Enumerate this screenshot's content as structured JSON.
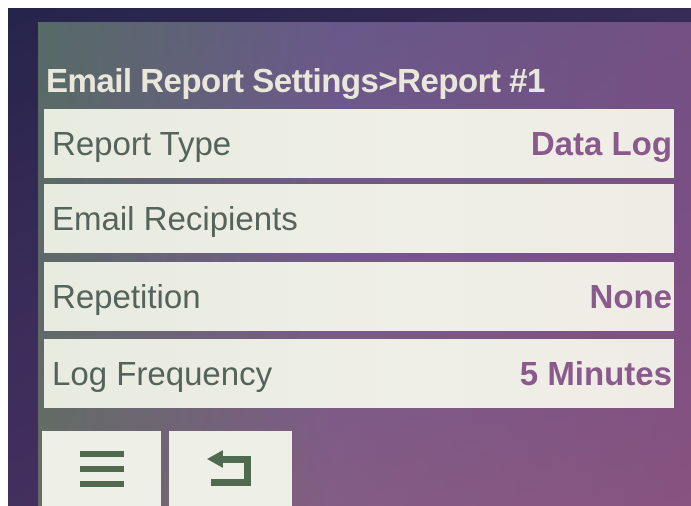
{
  "header": {
    "title": "Email Report Settings>Report #1"
  },
  "rows": [
    {
      "label": "Report Type",
      "value": "Data Log"
    },
    {
      "label": "Email Recipients",
      "value": ""
    },
    {
      "label": "Repetition",
      "value": "None"
    },
    {
      "label": "Log Frequency",
      "value": "5 Minutes"
    }
  ],
  "buttons": {
    "menu_icon": "hamburger-menu-icon",
    "back_icon": "return-arrow-icon"
  },
  "colors": {
    "row_bg": "#efefe6",
    "label_text": "#55635a",
    "value_text": "#8a5a8c",
    "title_text": "#e9e6da",
    "icon": "#4f6a4f"
  }
}
